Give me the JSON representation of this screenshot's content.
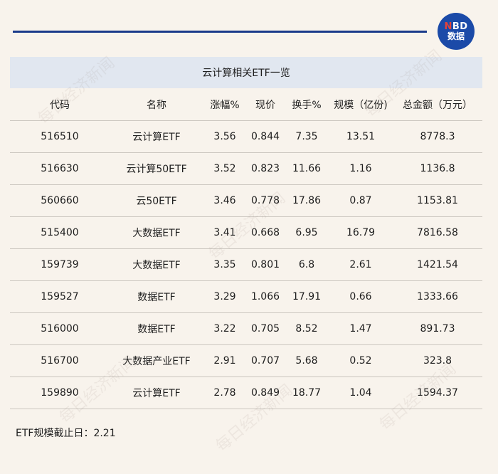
{
  "logo": {
    "top_text_n": "N",
    "top_text_rest": "BD",
    "bottom_text": "数据"
  },
  "table": {
    "title": "云计算相关ETF一览",
    "headers": [
      "代码",
      "名称",
      "涨幅%",
      "现价",
      "换手%",
      "规模（亿份)",
      "总金额（万元）"
    ],
    "rows": [
      [
        "516510",
        "云计算ETF",
        "3.56",
        "0.844",
        "7.35",
        "13.51",
        "8778.3"
      ],
      [
        "516630",
        "云计算50ETF",
        "3.52",
        "0.823",
        "11.66",
        "1.16",
        "1136.8"
      ],
      [
        "560660",
        "云50ETF",
        "3.46",
        "0.778",
        "17.86",
        "0.87",
        "1153.81"
      ],
      [
        "515400",
        "大数据ETF",
        "3.41",
        "0.668",
        "6.95",
        "16.79",
        "7816.58"
      ],
      [
        "159739",
        "大数据ETF",
        "3.35",
        "0.801",
        "6.8",
        "2.61",
        "1421.54"
      ],
      [
        "159527",
        "数据ETF",
        "3.29",
        "1.066",
        "17.91",
        "0.66",
        "1333.66"
      ],
      [
        "516000",
        "数据ETF",
        "3.22",
        "0.705",
        "8.52",
        "1.47",
        "891.73"
      ],
      [
        "516700",
        "大数据产业ETF",
        "2.91",
        "0.707",
        "5.68",
        "0.52",
        "323.8"
      ],
      [
        "159890",
        "云计算ETF",
        "2.78",
        "0.849",
        "18.77",
        "1.04",
        "1594.37"
      ]
    ]
  },
  "footnote": "ETF规模截止日：2.21",
  "watermark_text": "每日经济新闻",
  "colors": {
    "background": "#f8f3ec",
    "title_band": "#e1e7f0",
    "header_rule": "#1a3a8a",
    "logo_blue": "#1b4aa8",
    "logo_red": "#e0433b",
    "row_divider": "#cbc6bf"
  }
}
